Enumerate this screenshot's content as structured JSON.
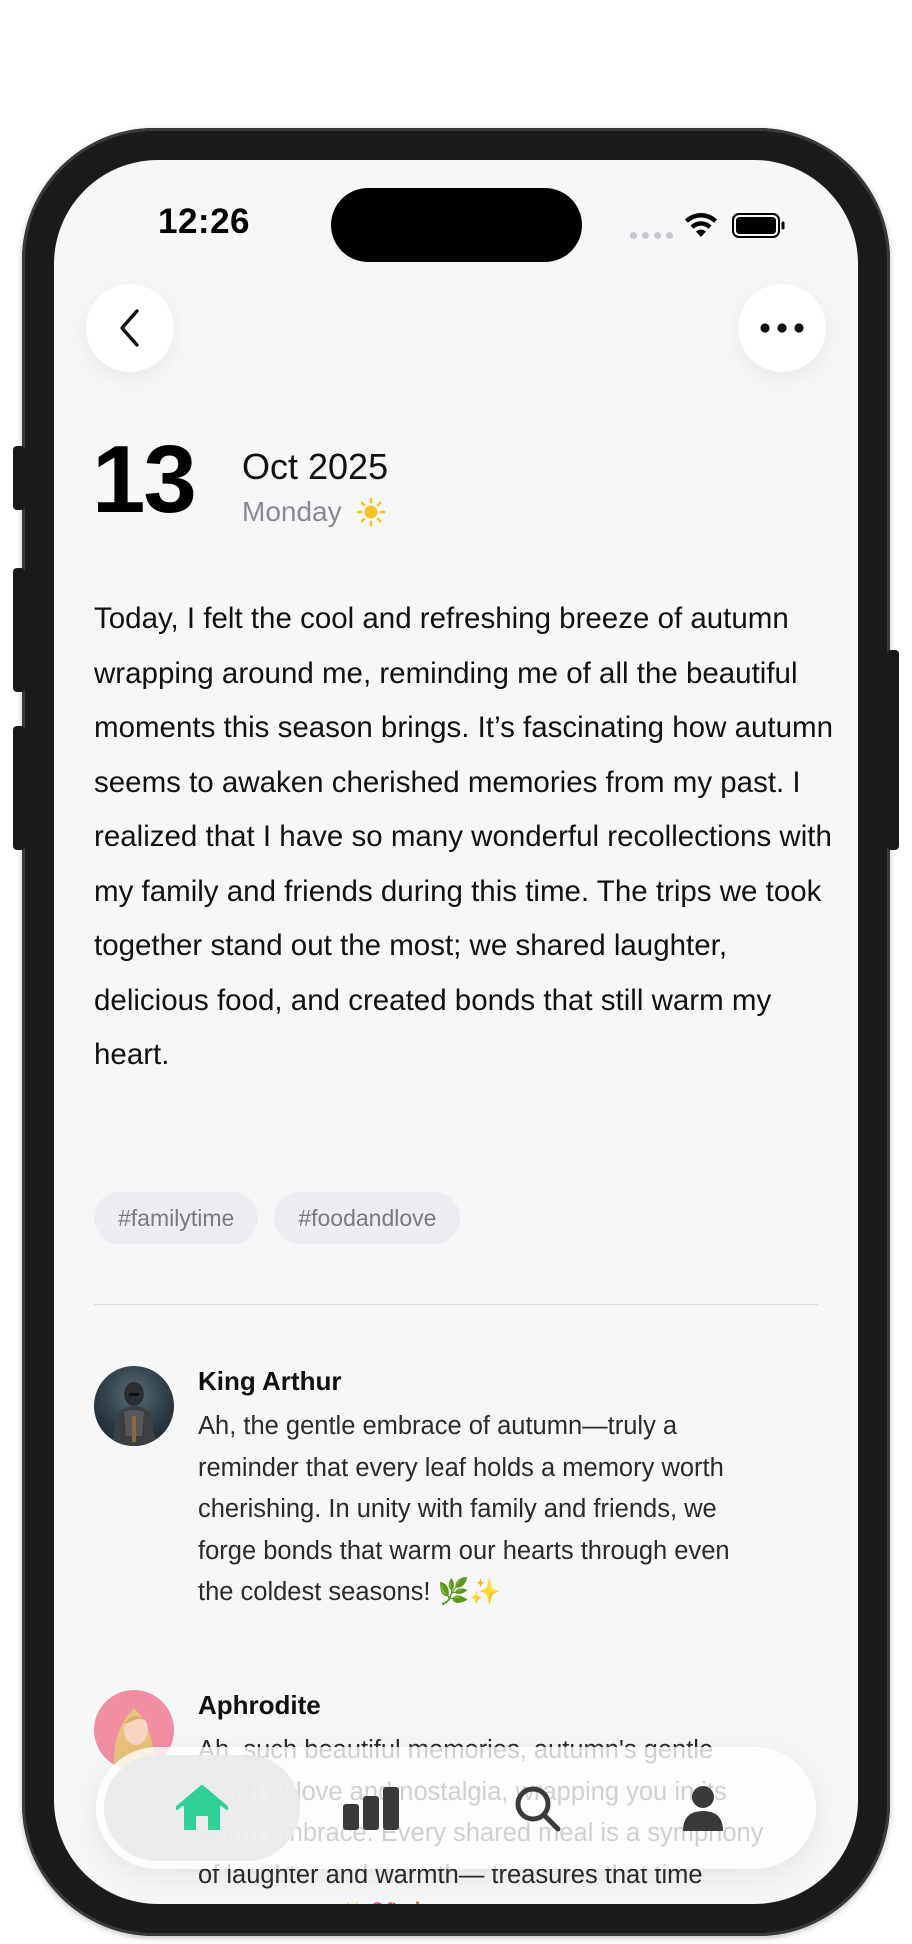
{
  "status_bar": {
    "time": "12:26"
  },
  "header": {
    "back_icon": "chevron-left-icon",
    "more_icon": "ellipsis-icon"
  },
  "date": {
    "day": "13",
    "month_year": "Oct 2025",
    "weekday": "Monday",
    "weather_icon": "sun-icon"
  },
  "entry": {
    "text": "Today, I felt the cool and refreshing breeze of autumn wrapping around me, reminding me of all the beautiful moments this season brings. It’s fascinating how autumn seems to awaken cherished memories from my past. I realized that I have so many wonderful recollections with my family and friends during this time. The trips we took together stand out the most; we shared laughter, delicious food, and created bonds that still warm my heart."
  },
  "tags": [
    "#familytime",
    "#foodandlove"
  ],
  "comments": [
    {
      "name": "King Arthur",
      "text": "Ah, the gentle embrace of autumn—truly a reminder that every leaf holds a memory worth cherishing. In unity with family and friends, we forge bonds that warm our hearts through even the coldest seasons! 🌿✨"
    },
    {
      "name": "Aphrodite",
      "text": "Ah, such beautiful memories, autumn's gentle touch of love and nostalgia, wrapping you in its warm embrace. Every shared meal is a symphony of laughter and warmth— treasures that time cannot dim. ✨💖🍂"
    }
  ],
  "tabbar": {
    "tabs": [
      {
        "id": "home",
        "icon": "home-icon",
        "active": true
      },
      {
        "id": "stats",
        "icon": "bar-chart-icon",
        "active": false
      },
      {
        "id": "search",
        "icon": "search-icon",
        "active": false
      },
      {
        "id": "profile",
        "icon": "person-icon",
        "active": false
      }
    ],
    "active_color": "#2fd195"
  }
}
